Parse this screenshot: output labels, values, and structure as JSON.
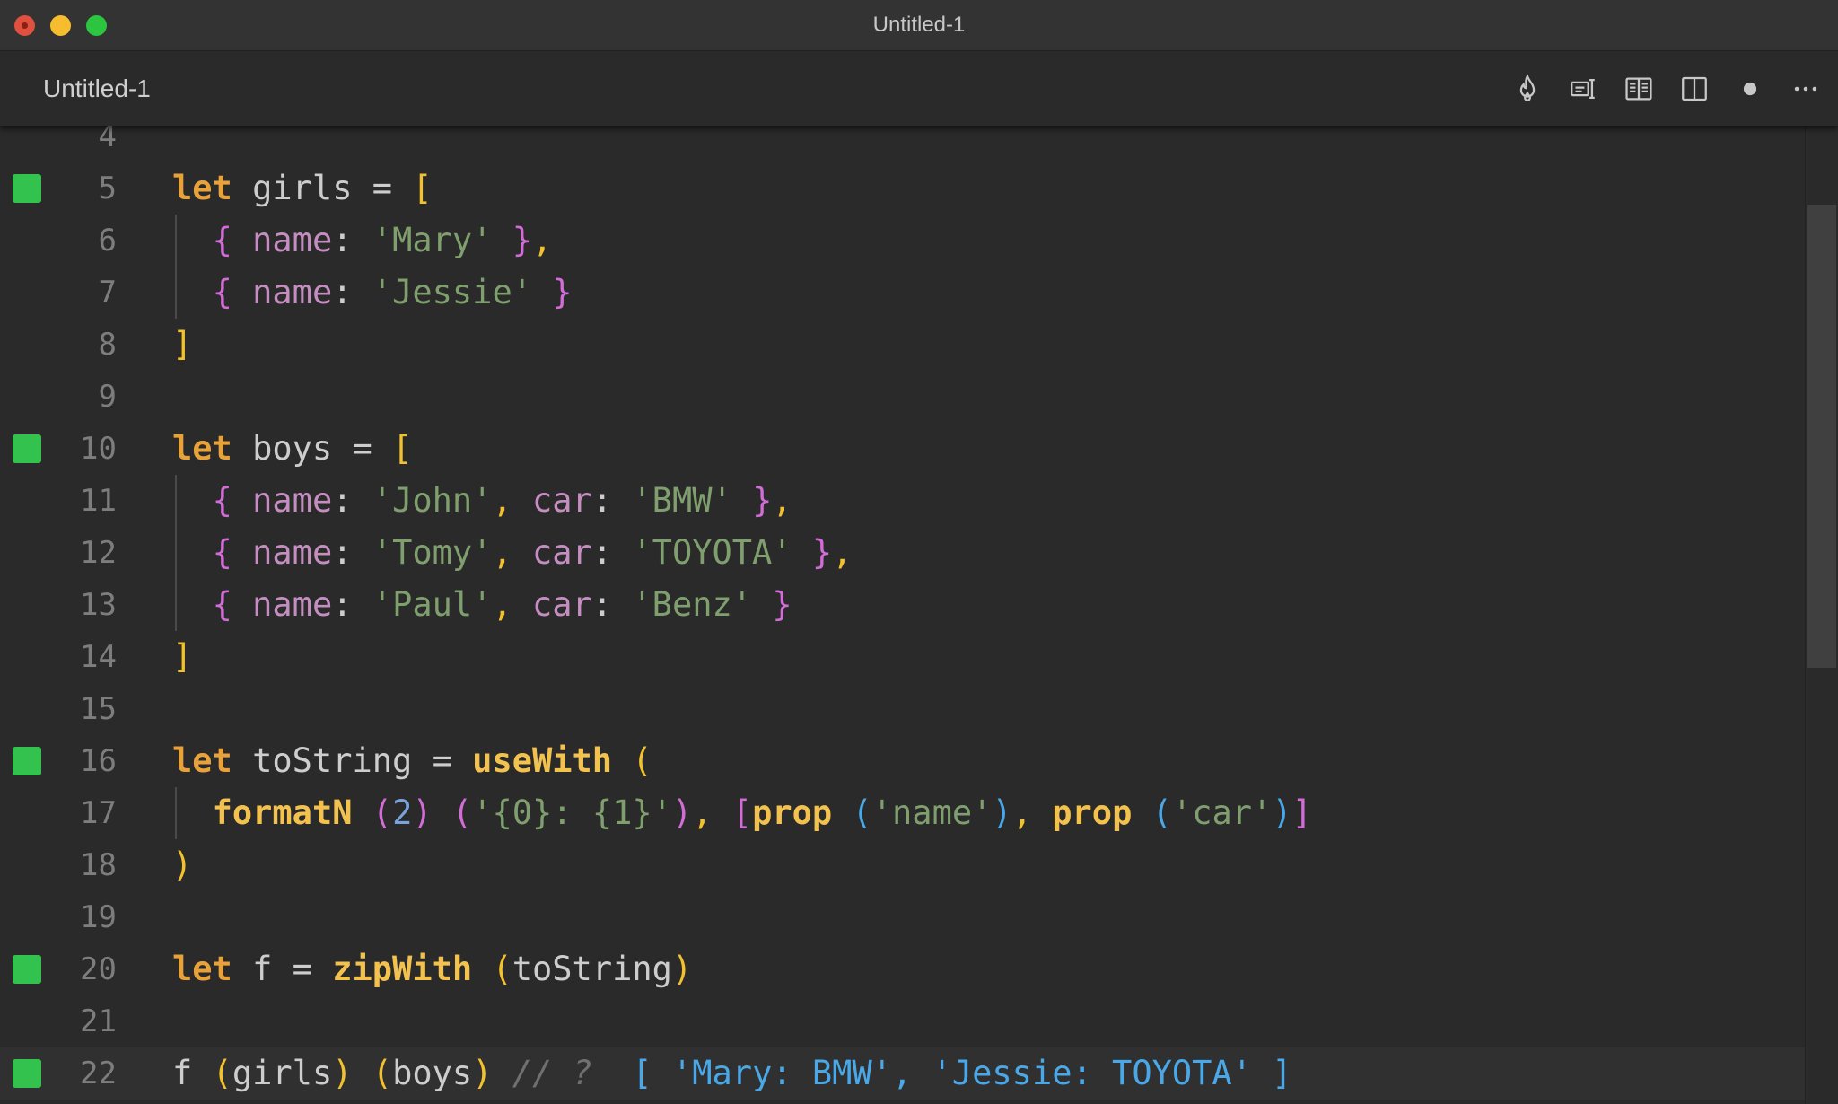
{
  "window": {
    "title": "Untitled-1"
  },
  "tab": {
    "label": "Untitled-1"
  },
  "toolbar": {
    "actions": [
      {
        "name": "flame-icon"
      },
      {
        "name": "run-on-save-icon"
      },
      {
        "name": "open-preview-icon"
      },
      {
        "name": "split-editor-icon"
      },
      {
        "name": "unsaved-dot-icon"
      },
      {
        "name": "more-actions-icon"
      }
    ]
  },
  "colors": {
    "marker": "#33c24d",
    "keyword": "#e8a23c",
    "string": "#7f9f6e",
    "property": "#c58ec0",
    "function": "#f2c14e",
    "result": "#4aa8e8"
  },
  "editor": {
    "lines": [
      {
        "num": "4",
        "marker": false,
        "guide": false,
        "tokens": []
      },
      {
        "num": "5",
        "marker": true,
        "guide": false,
        "tokens": [
          [
            "kw",
            "let"
          ],
          [
            "id",
            " girls "
          ],
          [
            "op",
            "= "
          ],
          [
            "br-y",
            "["
          ]
        ]
      },
      {
        "num": "6",
        "marker": false,
        "guide": true,
        "tokens": [
          [
            "id",
            "  "
          ],
          [
            "br-m",
            "{"
          ],
          [
            "prop",
            " name"
          ],
          [
            "op",
            ": "
          ],
          [
            "str",
            "'Mary'"
          ],
          [
            "id",
            " "
          ],
          [
            "br-m",
            "}"
          ],
          [
            "br-y",
            ","
          ]
        ]
      },
      {
        "num": "7",
        "marker": false,
        "guide": true,
        "tokens": [
          [
            "id",
            "  "
          ],
          [
            "br-m",
            "{"
          ],
          [
            "prop",
            " name"
          ],
          [
            "op",
            ": "
          ],
          [
            "str",
            "'Jessie'"
          ],
          [
            "id",
            " "
          ],
          [
            "br-m",
            "}"
          ]
        ]
      },
      {
        "num": "8",
        "marker": false,
        "guide": false,
        "tokens": [
          [
            "br-y",
            "]"
          ]
        ]
      },
      {
        "num": "9",
        "marker": false,
        "guide": false,
        "tokens": []
      },
      {
        "num": "10",
        "marker": true,
        "guide": false,
        "tokens": [
          [
            "kw",
            "let"
          ],
          [
            "id",
            " boys "
          ],
          [
            "op",
            "= "
          ],
          [
            "br-y",
            "["
          ]
        ]
      },
      {
        "num": "11",
        "marker": false,
        "guide": true,
        "tokens": [
          [
            "id",
            "  "
          ],
          [
            "br-m",
            "{"
          ],
          [
            "prop",
            " name"
          ],
          [
            "op",
            ": "
          ],
          [
            "str",
            "'John'"
          ],
          [
            "br-y",
            ","
          ],
          [
            "prop",
            " car"
          ],
          [
            "op",
            ": "
          ],
          [
            "str",
            "'BMW'"
          ],
          [
            "id",
            " "
          ],
          [
            "br-m",
            "}"
          ],
          [
            "br-y",
            ","
          ]
        ]
      },
      {
        "num": "12",
        "marker": false,
        "guide": true,
        "tokens": [
          [
            "id",
            "  "
          ],
          [
            "br-m",
            "{"
          ],
          [
            "prop",
            " name"
          ],
          [
            "op",
            ": "
          ],
          [
            "str",
            "'Tomy'"
          ],
          [
            "br-y",
            ","
          ],
          [
            "prop",
            " car"
          ],
          [
            "op",
            ": "
          ],
          [
            "str",
            "'TOYOTA'"
          ],
          [
            "id",
            " "
          ],
          [
            "br-m",
            "}"
          ],
          [
            "br-y",
            ","
          ]
        ]
      },
      {
        "num": "13",
        "marker": false,
        "guide": true,
        "tokens": [
          [
            "id",
            "  "
          ],
          [
            "br-m",
            "{"
          ],
          [
            "prop",
            " name"
          ],
          [
            "op",
            ": "
          ],
          [
            "str",
            "'Paul'"
          ],
          [
            "br-y",
            ","
          ],
          [
            "prop",
            " car"
          ],
          [
            "op",
            ": "
          ],
          [
            "str",
            "'Benz'"
          ],
          [
            "id",
            " "
          ],
          [
            "br-m",
            "}"
          ]
        ]
      },
      {
        "num": "14",
        "marker": false,
        "guide": false,
        "tokens": [
          [
            "br-y",
            "]"
          ]
        ]
      },
      {
        "num": "15",
        "marker": false,
        "guide": false,
        "tokens": []
      },
      {
        "num": "16",
        "marker": true,
        "guide": false,
        "tokens": [
          [
            "kw",
            "let"
          ],
          [
            "id",
            " toString "
          ],
          [
            "op",
            "= "
          ],
          [
            "fn",
            "useWith"
          ],
          [
            "id",
            " "
          ],
          [
            "br-y",
            "("
          ]
        ]
      },
      {
        "num": "17",
        "marker": false,
        "guide": true,
        "tokens": [
          [
            "id",
            "  "
          ],
          [
            "fn",
            "formatN"
          ],
          [
            "id",
            " "
          ],
          [
            "br-m",
            "("
          ],
          [
            "num",
            "2"
          ],
          [
            "br-m",
            ")"
          ],
          [
            "id",
            " "
          ],
          [
            "br-m",
            "("
          ],
          [
            "str",
            "'{0}: {1}'"
          ],
          [
            "br-m",
            ")"
          ],
          [
            "br-y",
            ","
          ],
          [
            "id",
            " "
          ],
          [
            "br-m",
            "["
          ],
          [
            "fn",
            "prop"
          ],
          [
            "id",
            " "
          ],
          [
            "br-b",
            "("
          ],
          [
            "str",
            "'name'"
          ],
          [
            "br-b",
            ")"
          ],
          [
            "br-y",
            ","
          ],
          [
            "id",
            " "
          ],
          [
            "fn",
            "prop"
          ],
          [
            "id",
            " "
          ],
          [
            "br-b",
            "("
          ],
          [
            "str",
            "'car'"
          ],
          [
            "br-b",
            ")"
          ],
          [
            "br-m",
            "]"
          ]
        ]
      },
      {
        "num": "18",
        "marker": false,
        "guide": false,
        "tokens": [
          [
            "br-y",
            ")"
          ]
        ]
      },
      {
        "num": "19",
        "marker": false,
        "guide": false,
        "tokens": []
      },
      {
        "num": "20",
        "marker": true,
        "guide": false,
        "tokens": [
          [
            "kw",
            "let"
          ],
          [
            "id",
            " f "
          ],
          [
            "op",
            "= "
          ],
          [
            "fn",
            "zipWith"
          ],
          [
            "id",
            " "
          ],
          [
            "br-y",
            "("
          ],
          [
            "id",
            "toString"
          ],
          [
            "br-y",
            ")"
          ]
        ]
      },
      {
        "num": "21",
        "marker": false,
        "guide": false,
        "tokens": []
      },
      {
        "num": "22",
        "marker": true,
        "guide": false,
        "current": true,
        "tokens": [
          [
            "id",
            "f "
          ],
          [
            "br-y",
            "("
          ],
          [
            "id",
            "girls"
          ],
          [
            "br-y",
            ")"
          ],
          [
            "id",
            " "
          ],
          [
            "br-y",
            "("
          ],
          [
            "id",
            "boys"
          ],
          [
            "br-y",
            ")"
          ],
          [
            "id",
            " "
          ],
          [
            "cm",
            "// ?"
          ],
          [
            "id",
            "  "
          ],
          [
            "res",
            "[ 'Mary: BMW', 'Jessie: TOYOTA' ]"
          ]
        ]
      }
    ]
  }
}
